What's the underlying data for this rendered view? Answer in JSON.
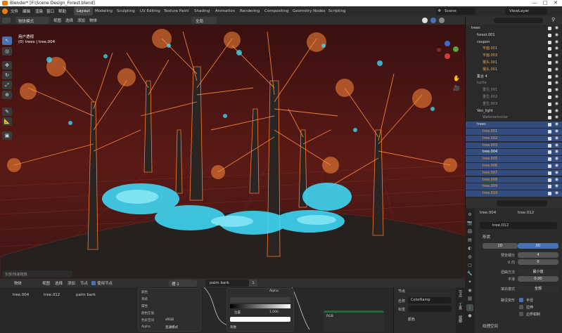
{
  "title": "Blender* [F:\\Scene Design_Forest.blend]",
  "window": {
    "min": "—",
    "max": "□",
    "close": "✕"
  },
  "menu": [
    "文件",
    "编辑",
    "渲染",
    "窗口",
    "帮助"
  ],
  "workspaces": [
    "Layout",
    "Modeling",
    "Sculpting",
    "UV Editing",
    "Texture Paint",
    "Shading",
    "Animation",
    "Rendering",
    "Compositing",
    "Geometry Nodes",
    "Scripting"
  ],
  "scene": "Scene",
  "viewlayer": "ViewLayer",
  "viewport": {
    "mode": "物体模式",
    "menus": [
      "视图",
      "选择",
      "添加",
      "物体"
    ],
    "transform": "全局",
    "info_title": "用户透视",
    "info_sub": "(0) trees | tree.004",
    "status": "长按/快速拖拽"
  },
  "nodes": {
    "menus": [
      "物体",
      "视图",
      "选择",
      "添加",
      "节点"
    ],
    "use_nodes": "使用节点",
    "material": "palm bark",
    "slot": "槽 1",
    "breadcrumb": [
      "tree.004",
      "tree.012",
      "palm bark"
    ],
    "ramp_label": "ColorRamp",
    "alpha": "Alpha",
    "fac": "系数",
    "val1": "1.000",
    "num": "1",
    "pos": "位置",
    "rgb": "RGB",
    "node_left": [
      "颜色",
      "系统",
      "属性",
      "颜色在值",
      "色彩空间",
      "Alpha"
    ],
    "node_left_vals": [
      "",
      "",
      "",
      "",
      "sRGB",
      "直通模式"
    ],
    "panel": {
      "tab": "节点",
      "name_lbl": "名称",
      "name_val": "ColorRamp",
      "label_lbl": "标签",
      "color_lbl": "颜色"
    },
    "side_tabs": [
      "节点",
      "工具",
      "视图"
    ]
  },
  "outliner": {
    "rows": [
      {
        "t": "trees",
        "i": 0,
        "c": "#d9d9d9",
        "sel": false
      },
      {
        "t": "forest.001",
        "i": 1,
        "c": "#d9d9d9",
        "sel": false
      },
      {
        "t": "coupon",
        "i": 1,
        "c": "#d9d9d9",
        "sel": false
      },
      {
        "t": "平面.001",
        "i": 2,
        "c": "#e6a04e",
        "sel": false
      },
      {
        "t": "平面.003",
        "i": 2,
        "c": "#e6a04e",
        "sel": false
      },
      {
        "t": "猴头.001",
        "i": 2,
        "c": "#e6a04e",
        "sel": false
      },
      {
        "t": "猴头.001",
        "i": 2,
        "c": "#e6a04e",
        "sel": false
      },
      {
        "t": "集合 4",
        "i": 1,
        "c": "#d9d9d9",
        "sel": false
      },
      {
        "t": "turtle",
        "i": 1,
        "c": "#8a8a8a",
        "sel": false
      },
      {
        "t": "重生.001",
        "i": 2,
        "c": "#8a8a8a",
        "sel": false
      },
      {
        "t": "重生.002",
        "i": 2,
        "c": "#8a8a8a",
        "sel": false
      },
      {
        "t": "重生.003",
        "i": 2,
        "c": "#8a8a8a",
        "sel": false
      },
      {
        "t": "Ven_light",
        "i": 1,
        "c": "#d9d9d9",
        "sel": false
      },
      {
        "t": "Watersetcollar",
        "i": 2,
        "c": "#8a8a8a",
        "sel": false
      },
      {
        "t": "trees",
        "i": 1,
        "c": "#d9d9d9",
        "sel": true
      },
      {
        "t": "tree.001",
        "i": 2,
        "c": "#e6a04e",
        "sel": true
      },
      {
        "t": "tree.002",
        "i": 2,
        "c": "#e6a04e",
        "sel": true
      },
      {
        "t": "tree.003",
        "i": 2,
        "c": "#e6a04e",
        "sel": true
      },
      {
        "t": "tree.004",
        "i": 2,
        "c": "#ffffff",
        "sel": true
      },
      {
        "t": "tree.005",
        "i": 2,
        "c": "#e6a04e",
        "sel": true
      },
      {
        "t": "tree.006",
        "i": 2,
        "c": "#e6a04e",
        "sel": true
      },
      {
        "t": "tree.007",
        "i": 2,
        "c": "#e6a04e",
        "sel": true
      },
      {
        "t": "tree.008",
        "i": 2,
        "c": "#e6a04e",
        "sel": true
      },
      {
        "t": "tree.009",
        "i": 2,
        "c": "#e6a04e",
        "sel": true
      },
      {
        "t": "tree.010",
        "i": 2,
        "c": "#e6a04e",
        "sel": true
      }
    ]
  },
  "props": {
    "obj": "tree.004",
    "data": "tree.012",
    "mesh": "tree.012",
    "section": "形状",
    "dims": [
      "2D",
      "3D"
    ],
    "rows": [
      {
        "l": "预览细分",
        "v": "4"
      },
      {
        "l": "U 向",
        "v": "0"
      },
      {
        "l": "扭曲方法",
        "v": "最小值"
      },
      {
        "l": "平滑",
        "v": "0.00"
      }
    ],
    "fill_lbl": "填充模式",
    "fill_val": "全部",
    "deform": "路径变形",
    "cb1": "半径",
    "cb2": "拉伸",
    "cb3": "边界钳制",
    "texspace": "纹理空间"
  },
  "colors": {
    "accent": "#4772b3",
    "sel": "#334d80",
    "orange": "#ff8a3a",
    "cyan": "#3fe0ff"
  }
}
